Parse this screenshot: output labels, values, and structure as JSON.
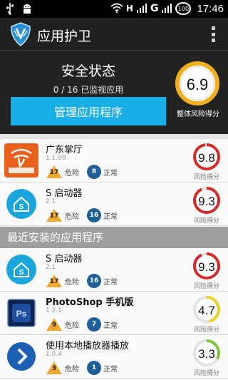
{
  "status_bar": {
    "time": "17:46",
    "battery": "100",
    "signal_g": "G",
    "signal_h": "H"
  },
  "app": {
    "title": "应用护卫"
  },
  "header": {
    "status_title": "安全状态",
    "monitor_text": "0 / 16 已监视应用",
    "manage_button": "管理应用程序",
    "overall_score": "6.9",
    "overall_score_label": "整体风险得分"
  },
  "labels": {
    "danger": "危险",
    "normal": "正常",
    "risk_score": "风险得分"
  },
  "section_recent": "最近安装的应用程序",
  "apps": [
    {
      "name": "广东掌厅",
      "version": "1.1.98",
      "danger": "17",
      "normal": "8",
      "score": "9.8",
      "ring_color": "#d32a2a",
      "ring_fraction": 0.98
    },
    {
      "name": "S 启动器",
      "version": "2.1",
      "danger": "17",
      "normal": "16",
      "score": "9.3",
      "ring_color": "#d32a2a",
      "ring_fraction": 0.93
    },
    {
      "name": "S 启动器",
      "version": "2.1",
      "danger": "17",
      "normal": "16",
      "score": "9.3",
      "ring_color": "#d32a2a",
      "ring_fraction": 0.93
    },
    {
      "name": "PhotoShop 手机版",
      "version": "1.2.1",
      "danger": "9",
      "normal": "7",
      "score": "4.7",
      "ring_color": "#e9d21f",
      "ring_fraction": 0.47
    },
    {
      "name": "使用本地播放器播放",
      "version": "1.0.4",
      "danger": "3",
      "normal": "1",
      "score": "3.3",
      "ring_color": "#7cc43a",
      "ring_fraction": 0.33
    }
  ],
  "colors": {
    "accent": "#18aee6",
    "danger_badge": "#f0a830",
    "normal_badge": "#1e5f97"
  }
}
